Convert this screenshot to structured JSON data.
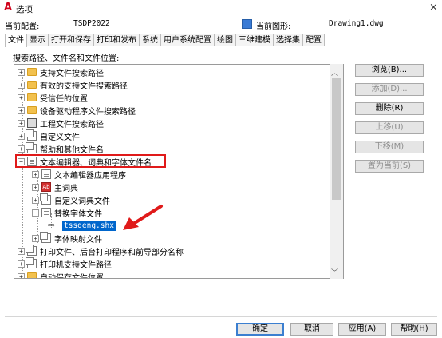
{
  "window": {
    "title": "选项",
    "close": "×"
  },
  "profile": {
    "current_config_label": "当前配置:",
    "current_config_value": "TSDP2022",
    "current_drawing_label": "当前图形:",
    "current_drawing_value": "Drawing1.dwg"
  },
  "tabs": [
    "文件",
    "显示",
    "打开和保存",
    "打印和发布",
    "系统",
    "用户系统配置",
    "绘图",
    "三维建模",
    "选择集",
    "配置"
  ],
  "section_label": "搜索路径、文件名和文件位置:",
  "tree": {
    "items": [
      "支持文件搜索路径",
      "有效的支持文件搜索路径",
      "受信任的位置",
      "设备驱动程序文件搜索路径",
      "工程文件搜索路径",
      "自定义文件",
      "帮助和其他文件名",
      "文本编辑器、词典和字体文件名",
      "文本编辑器应用程序",
      "主词典",
      "自定义词典文件",
      "替换字体文件",
      "tssdeng.shx",
      "字体映射文件",
      "打印文件、后台打印程序和前导部分名称",
      "打印机支持文件路径",
      "自动保存文件位置"
    ]
  },
  "buttons_right": {
    "browse": "浏览(B)...",
    "add": "添加(D)...",
    "remove": "删除(R)",
    "move_up": "上移(U)",
    "move_down": "下移(M)",
    "set_current": "置为当前(S)"
  },
  "buttons_bottom": {
    "ok": "确定",
    "cancel": "取消",
    "apply": "应用(A)",
    "help": "帮助(H)"
  },
  "colors": {
    "highlight": "#0066cc",
    "callout": "#e01a1a"
  }
}
